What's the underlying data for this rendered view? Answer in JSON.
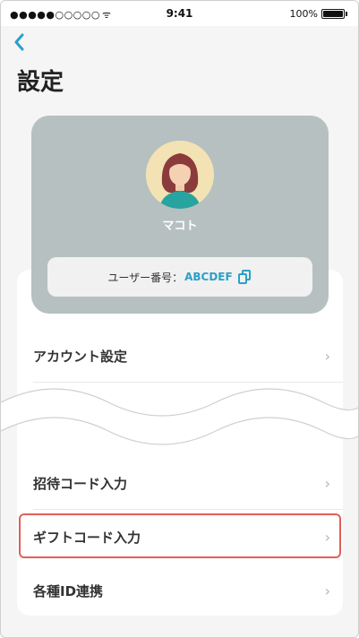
{
  "status_bar": {
    "signal": "●●●●●○○○○○",
    "wifi_icon": "wifi-icon",
    "time": "9:41",
    "battery": "100%"
  },
  "header": {
    "back_icon": "chevron-left-icon",
    "title": "設定"
  },
  "profile": {
    "name": "マコト",
    "user_id_label": "ユーザー番号：",
    "user_id": "ABCDEF",
    "copy_icon": "copy-icon"
  },
  "menu": {
    "items": [
      {
        "label": "アカウント設定"
      },
      {
        "label": "招待コード入力"
      },
      {
        "label": "ギフトコード入力"
      },
      {
        "label": "各種ID連携"
      }
    ],
    "chevron": "›"
  },
  "colors": {
    "accent": "#2aa0c8",
    "profile_card": "#b7c0c0",
    "highlight": "#e0605a"
  }
}
